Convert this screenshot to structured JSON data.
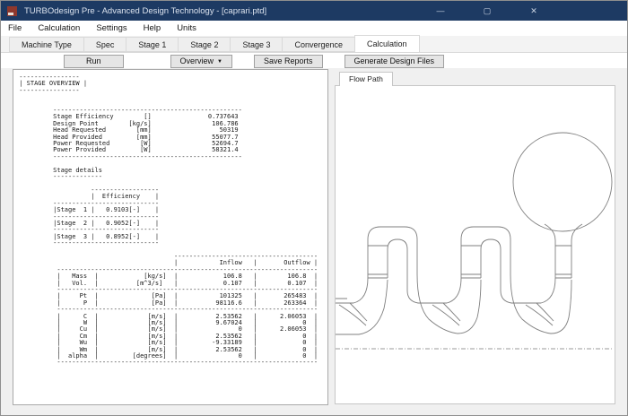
{
  "window": {
    "title": "TURBOdesign Pre - Advanced Design Technology - [caprari.ptd]",
    "controls": {
      "minimize": "—",
      "maximize": "▢",
      "close": "✕"
    }
  },
  "menu": {
    "items": [
      "File",
      "Calculation",
      "Settings",
      "Help",
      "Units"
    ]
  },
  "tabs": {
    "items": [
      "Machine Type",
      "Spec",
      "Stage 1",
      "Stage 2",
      "Stage 3",
      "Convergence",
      "Calculation"
    ],
    "active_index": 6
  },
  "toolbar": {
    "run": "Run",
    "overview": "Overview",
    "overview_caret": "▼",
    "save_reports": "Save Reports",
    "generate": "Generate Design Files"
  },
  "flow_path": {
    "tab": "Flow Path"
  },
  "report": {
    "title": "STAGE OVERVIEW",
    "stage_overview": {
      "stage_efficiency": "0.737643",
      "design_point_kg_s": "106.786",
      "head_requested_mm": "50319",
      "head_provided_mm": "55077.7",
      "power_requested_w": "52694.7",
      "power_provided_w": "58321.4"
    },
    "stage_details": [
      {
        "stage": "Stage 1",
        "efficiency": "0.9103[-]"
      },
      {
        "stage": "Stage 2",
        "efficiency": "0.9052[-]"
      },
      {
        "stage": "Stage 3",
        "efficiency": "0.8952[-]"
      }
    ],
    "flow_table": [
      {
        "name": "Mass",
        "unit": "[kg/s]",
        "inflow": "106.8",
        "outflow": "106.8"
      },
      {
        "name": "Vol.",
        "unit": "[m^3/s]",
        "inflow": "0.107",
        "outflow": "0.107"
      },
      {
        "name": "Pt",
        "unit": "[Pa]",
        "inflow": "101325",
        "outflow": "265483"
      },
      {
        "name": "P",
        "unit": "[Pa]",
        "inflow": "98116.6",
        "outflow": "263364"
      },
      {
        "name": "C",
        "unit": "[m/s]",
        "inflow": "2.53562",
        "outflow": "2.06053"
      },
      {
        "name": "W",
        "unit": "[m/s]",
        "inflow": "9.67024",
        "outflow": "0"
      },
      {
        "name": "Cu",
        "unit": "[m/s]",
        "inflow": "0",
        "outflow": "2.06053"
      },
      {
        "name": "Cm",
        "unit": "[m/s]",
        "inflow": "2.53562",
        "outflow": "0"
      },
      {
        "name": "Wu",
        "unit": "[m/s]",
        "inflow": "-9.33189",
        "outflow": "0"
      },
      {
        "name": "Wm",
        "unit": "[m/s]",
        "inflow": "2.53562",
        "outflow": "0"
      },
      {
        "name": "alpha",
        "unit": "[degrees]",
        "inflow": "0",
        "outflow": "0"
      }
    ],
    "lines": [
      " ----------------",
      " | STAGE OVERVIEW |",
      " ----------------",
      "",
      "",
      "          --------------------------------------------------",
      "          Stage Efficiency        []               0.737643",
      "          Design Point        [kg/s]                106.786",
      "          Head Requested        [mm]                  50319",
      "          Head Provided         [mm]                55077.7",
      "          Power Requested        [W]                52694.7",
      "          Power Provided         [W]                58321.4",
      "          --------------------------------------------------",
      "",
      "          Stage details",
      "          -------------",
      "",
      "                    ------------------",
      "                    |  Efficiency    |",
      "          ----------------------------",
      "          |Stage  1 |   0.9103[-]    |",
      "          ----------------------------",
      "          |Stage  2 |   0.9052[-]    |",
      "          ----------------------------",
      "          |Stage  3 |   0.8952[-]    |",
      "          ----------------------------",
      "",
      "                                          --------------------------------------",
      "                                          |           Inflow   |       Outflow |",
      "           ---------------------------------------------------------------------",
      "           |   Mass  |            [kg/s]  |            106.8   |        106.8  |",
      "           |   Vol.  |          [m^3/s]   |            0.107   |        0.107  |",
      "           ---------------------------------------------------------------------",
      "           |     Pt  |              [Pa]  |           101325   |       265483  |",
      "           |      P  |              [Pa]  |          98116.6   |       263364  |",
      "           ---------------------------------------------------------------------",
      "           |      C  |             [m/s]  |          2.53562   |      2.06053  |",
      "           |      W  |             [m/s]  |          9.67024   |            0  |",
      "           |     Cu  |             [m/s]  |                0   |      2.06053  |",
      "           |     Cm  |             [m/s]  |          2.53562   |            0  |",
      "           |     Wu  |             [m/s]  |         -9.33189   |            0  |",
      "           |     Wm  |             [m/s]  |          2.53562   |            0  |",
      "           |  alpha  |         [degrees]  |                0   |            0  |",
      "           ---------------------------------------------------------------------"
    ]
  },
  "colors": {
    "titlebar": "#1d3a63",
    "app_icon_red": "#8f382d",
    "content_bg": "#f0f0f0",
    "diagram_stroke": "#7f7f7f"
  }
}
